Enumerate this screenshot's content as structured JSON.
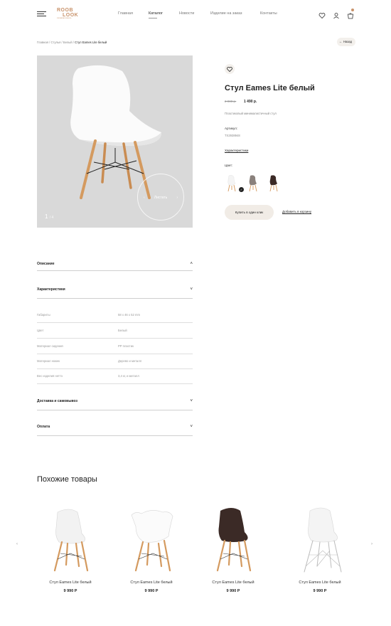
{
  "header": {
    "logo_line1": "ROOB",
    "logo_line2": "LOOK",
    "logo_tagline": "ЖЕЛАЕМАЯ МЕБЕЛЬ",
    "nav": [
      "Главная",
      "Каталог",
      "Новости",
      "Изделие на заказ",
      "Контакты"
    ],
    "active_nav": "Каталог",
    "icons": [
      "heart-icon",
      "user-icon",
      "cart-icon"
    ],
    "accent_color": "#c8926a"
  },
  "breadcrumb": {
    "items": [
      "Главная",
      "Стулья",
      "Белый"
    ],
    "current": "Стул Eames Lite белый",
    "separator": "/"
  },
  "back_label": "Назад",
  "gallery": {
    "current": "1",
    "total": "/ 4",
    "swipe_label": "Листать"
  },
  "product": {
    "title": "Стул Eames Lite белый",
    "old_price": "2 980 р.",
    "new_price": "1 490 р.",
    "description": "Пластиковый минималистичный стул",
    "article_label": "Артикул:",
    "article_value": "TX2938948",
    "characteristics_link": "Характеристики",
    "color_label": "Цвет:",
    "colors": [
      {
        "name": "белый",
        "seat": "#f4f4f4",
        "selected": true
      },
      {
        "name": "серый",
        "seat": "#8a817c",
        "selected": false
      },
      {
        "name": "коричневый",
        "seat": "#3b2a26",
        "selected": false
      }
    ],
    "buy_one_click": "Купить в один клик",
    "add_to_cart": "Добавить в корзину"
  },
  "accordions": {
    "description": "Описание",
    "characteristics": "Характеристики",
    "delivery": "Доставка и самовывоз",
    "payment": "Оплата",
    "rows": [
      {
        "k": "Габариты",
        "v": "58 x 46 x 52  mm"
      },
      {
        "k": "Цвет",
        "v": "Белый"
      },
      {
        "k": "Материал сидения",
        "v": "PP пластик"
      },
      {
        "k": "Материал ножек",
        "v": "Дерево и металл"
      },
      {
        "k": "Вес изделия нетто",
        "v": "3,4 кг, и металл"
      }
    ]
  },
  "similar": {
    "title": "Похожие товары",
    "items": [
      {
        "name": "Стул Eames Lite белый",
        "price": "9 990 Р"
      },
      {
        "name": "Стул Eames Lite белый",
        "price": "9 990 Р"
      },
      {
        "name": "Стул Eames Lite белый",
        "price": "9 990 Р"
      },
      {
        "name": "Стул Eames Lite белый",
        "price": "9 990 Р"
      }
    ]
  }
}
